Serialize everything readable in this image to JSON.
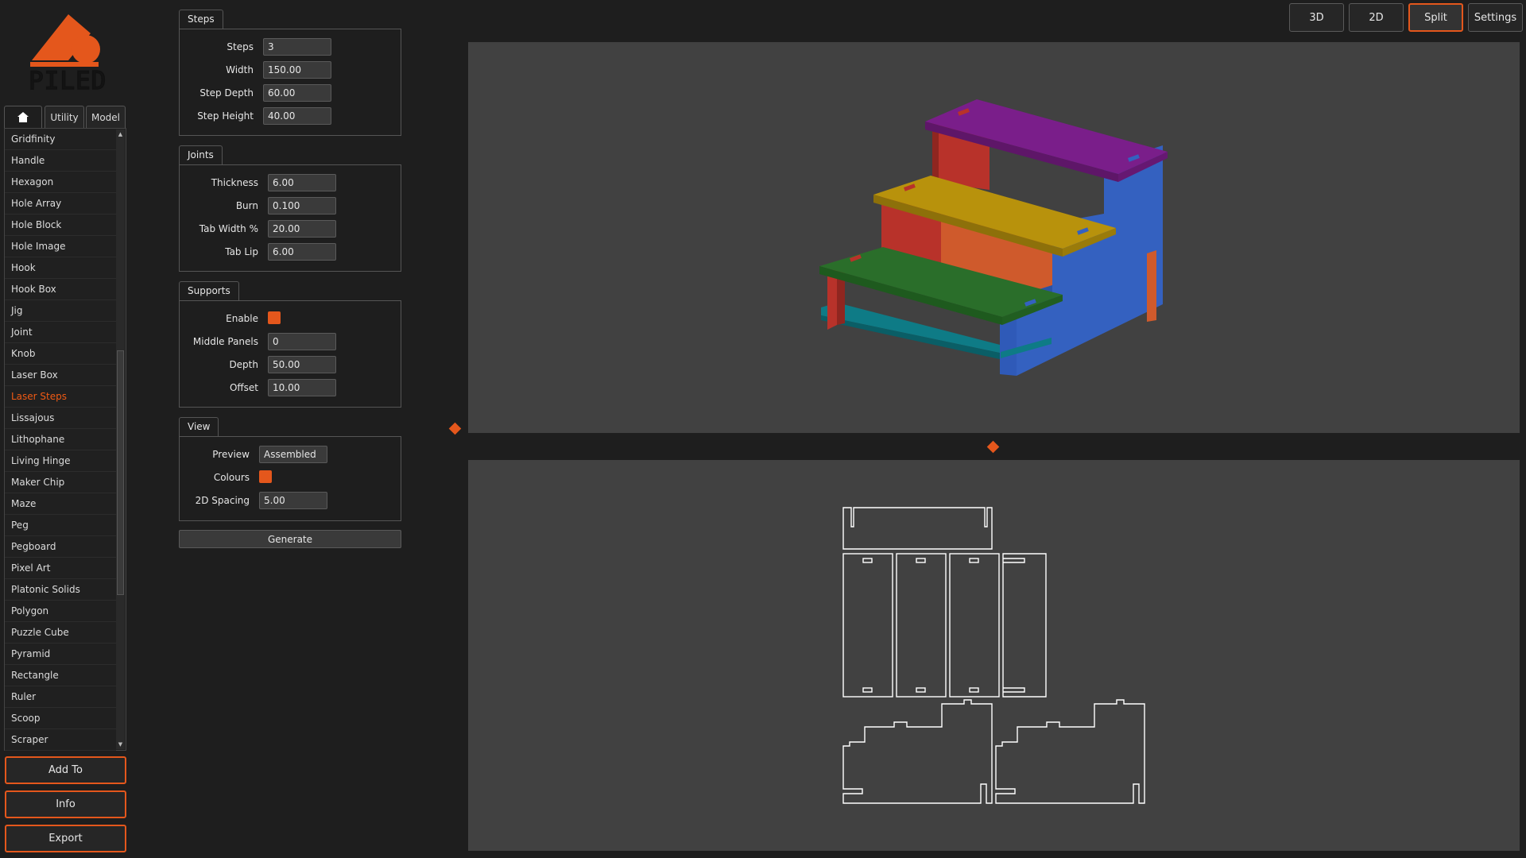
{
  "logo": {
    "text": "PILED",
    "color": "#e4571c"
  },
  "left_tabs": [
    {
      "label": "",
      "icon": "home-icon"
    },
    {
      "label": "Utility"
    },
    {
      "label": "Model"
    }
  ],
  "items": [
    "Gridfinity",
    "Handle",
    "Hexagon",
    "Hole Array",
    "Hole Block",
    "Hole Image",
    "Hook",
    "Hook Box",
    "Jig",
    "Joint",
    "Knob",
    "Laser Box",
    "Laser Steps",
    "Lissajous",
    "Lithophane",
    "Living Hinge",
    "Maker Chip",
    "Maze",
    "Peg",
    "Pegboard",
    "Pixel Art",
    "Platonic Solids",
    "Polygon",
    "Puzzle Cube",
    "Pyramid",
    "Rectangle",
    "Ruler",
    "Scoop",
    "Scraper"
  ],
  "selected_item": "Laser Steps",
  "side_buttons": {
    "add_to": "Add To",
    "info": "Info",
    "export": "Export"
  },
  "groups": {
    "steps": {
      "title": "Steps",
      "steps_label": "Steps",
      "steps_value": "3",
      "width_label": "Width",
      "width_value": "150.00",
      "depth_label": "Step Depth",
      "depth_value": "60.00",
      "height_label": "Step Height",
      "height_value": "40.00"
    },
    "joints": {
      "title": "Joints",
      "thickness_label": "Thickness",
      "thickness_value": "6.00",
      "burn_label": "Burn",
      "burn_value": "0.100",
      "tab_width_label": "Tab Width %",
      "tab_width_value": "20.00",
      "tab_lip_label": "Tab Lip",
      "tab_lip_value": "6.00"
    },
    "supports": {
      "title": "Supports",
      "enable_label": "Enable",
      "enable_checked": true,
      "middle_label": "Middle Panels",
      "middle_value": "0",
      "depth_label": "Depth",
      "depth_value": "50.00",
      "offset_label": "Offset",
      "offset_value": "10.00"
    },
    "view": {
      "title": "View",
      "preview_label": "Preview",
      "preview_value": "Assembled",
      "colours_label": "Colours",
      "colours_checked": true,
      "spacing_label": "2D Spacing",
      "spacing_value": "5.00"
    }
  },
  "generate_label": "Generate",
  "view_modes": {
    "mode_3d": "3D",
    "mode_2d": "2D",
    "mode_split": "Split",
    "settings": "Settings",
    "active": "Split"
  },
  "colors": {
    "accent": "#e4571c",
    "viewport_bg": "#414141",
    "purple": "#7a1e8a",
    "gold": "#b8920c",
    "green": "#2a6e2a",
    "teal": "#0e7b86",
    "red": "#b8322a",
    "orange": "#cf5a2c",
    "blue": "#3461c0"
  }
}
